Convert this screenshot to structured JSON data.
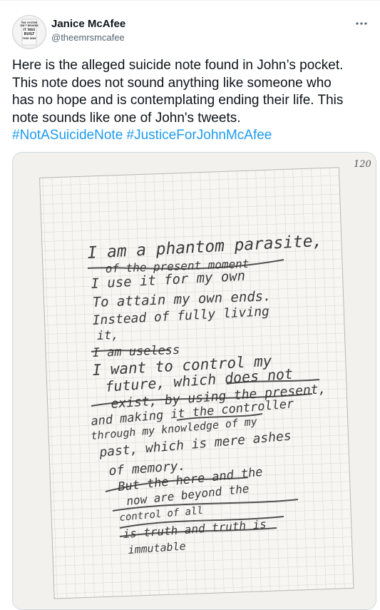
{
  "author": {
    "display_name": "Janice McAfee",
    "handle": "@theemrsmcafee",
    "avatar_text": "THE SYSTEM ISN'T BROKEN IT WAS BUILT THIS WAY"
  },
  "menu_icon": "more-horizontal-icon",
  "tweet": {
    "lines": [
      "Here is the alleged suicide note found in John’s pocket.",
      "This note does not sound anything like someone who",
      "has no hope and is contemplating ending their life. This",
      "note sounds like one of John's tweets."
    ],
    "hashtags": [
      "#NotASuicideNote",
      "#JusticeForJohnMcAfee"
    ]
  },
  "note": {
    "page_number": "120",
    "lines": [
      "I am a phantom parasite,",
      "of the present moment",
      "I use it for my own",
      "To attain my own ends.",
      "Instead of fully living",
      "it,",
      "I am useless",
      "I want to control my",
      "future, which does not",
      "exist, by using the present,",
      "and making it the controller",
      "through my knowledge of my",
      "past, which is mere ashes",
      "of memory.",
      "But the here and the",
      "now are beyond the",
      "control of all",
      "is truth and truth is",
      "immutable"
    ]
  },
  "colors": {
    "hashtag": "#1d9bf0",
    "handle": "#536471",
    "text": "#0f1419",
    "border": "#cfd9de"
  }
}
